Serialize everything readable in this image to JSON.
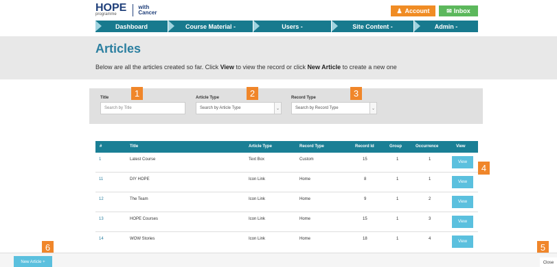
{
  "header": {
    "logo_main": "HOPE",
    "logo_sub": "programme",
    "logo_with": "with",
    "logo_cancer": "Cancer",
    "account_label": "Account",
    "inbox_label": "Inbox",
    "account_color": "#f08c24",
    "inbox_color": "#5cb85c"
  },
  "nav": {
    "items": [
      {
        "label": "Dashboard"
      },
      {
        "label": "Course Material -"
      },
      {
        "label": "Users -"
      },
      {
        "label": "Site Content -"
      },
      {
        "label": "Admin -"
      }
    ]
  },
  "page": {
    "title": "Articles",
    "desc_1": "Below are all the articles created so far. Click ",
    "desc_view": "View",
    "desc_2": " to view the record or click ",
    "desc_new": "New Article",
    "desc_3": " to create a new one"
  },
  "filters": {
    "title_label": "Title",
    "title_placeholder": "Search by Title",
    "article_type_label": "Article Type",
    "article_type_value": "Search by Article Type",
    "record_type_label": "Record Type",
    "record_type_value": "Search by Record Type"
  },
  "callouts": [
    "1",
    "2",
    "3",
    "4",
    "5",
    "6"
  ],
  "table": {
    "headers": [
      "#",
      "Title",
      "Article Type",
      "Record Type",
      "Record Id",
      "Group",
      "Occurrence",
      "View"
    ],
    "rows": [
      {
        "num": "1",
        "title": "Latest Course",
        "article_type": "Text Box",
        "record_type": "Custom",
        "record_id": "15",
        "group": "1",
        "occurrence": "1",
        "view": "View"
      },
      {
        "num": "11",
        "title": "DIY HOPE",
        "article_type": "Icon Link",
        "record_type": "Home",
        "record_id": "8",
        "group": "1",
        "occurrence": "1",
        "view": "View"
      },
      {
        "num": "12",
        "title": "The Team",
        "article_type": "Icon Link",
        "record_type": "Home",
        "record_id": "9",
        "group": "1",
        "occurrence": "2",
        "view": "View"
      },
      {
        "num": "13",
        "title": "HOPE Courses",
        "article_type": "Icon Link",
        "record_type": "Home",
        "record_id": "15",
        "group": "1",
        "occurrence": "3",
        "view": "View"
      },
      {
        "num": "14",
        "title": "WOW Stories",
        "article_type": "Icon Link",
        "record_type": "Home",
        "record_id": "18",
        "group": "1",
        "occurrence": "4",
        "view": "View"
      }
    ]
  },
  "bottom": {
    "new_article_label": "New Article +",
    "close_label": "Close"
  },
  "colors": {
    "nav": "#187a8e",
    "table_header": "#1a7f95",
    "view_button": "#5bc0de",
    "callout": "#f0862a",
    "title": "#2b7fa0"
  }
}
